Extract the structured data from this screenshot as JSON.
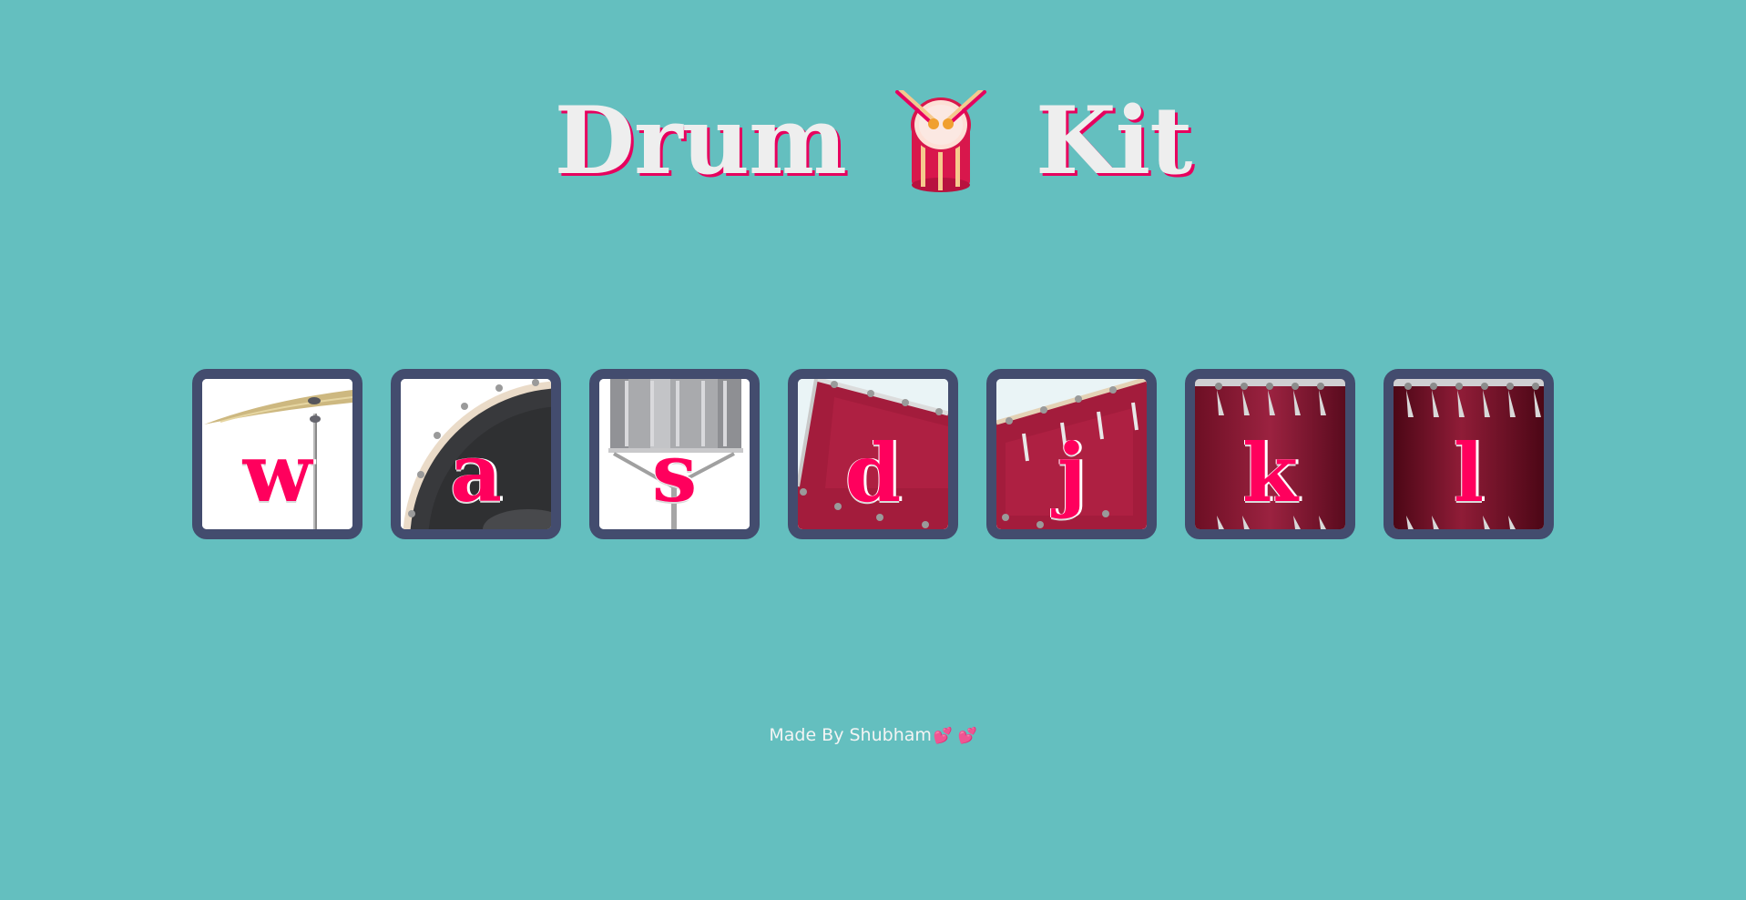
{
  "header": {
    "title_left": "Drum",
    "title_icon": "drum-with-sticks-emoji",
    "title_right": "Kit"
  },
  "drums": [
    {
      "key": "w",
      "image": "crash-cymbal"
    },
    {
      "key": "a",
      "image": "kick-bass-drum"
    },
    {
      "key": "s",
      "image": "snare-drum"
    },
    {
      "key": "d",
      "image": "tom-1"
    },
    {
      "key": "j",
      "image": "tom-2"
    },
    {
      "key": "k",
      "image": "tom-3"
    },
    {
      "key": "l",
      "image": "tom-4"
    }
  ],
  "footer": {
    "text": "Made By Shubham",
    "hearts": "💕 💕"
  },
  "colors": {
    "background": "#64bfbf",
    "button_border": "#434c6e",
    "key_letter": "#ff005d",
    "title_text": "#eeeeee",
    "title_shadow": "#e7005e"
  }
}
